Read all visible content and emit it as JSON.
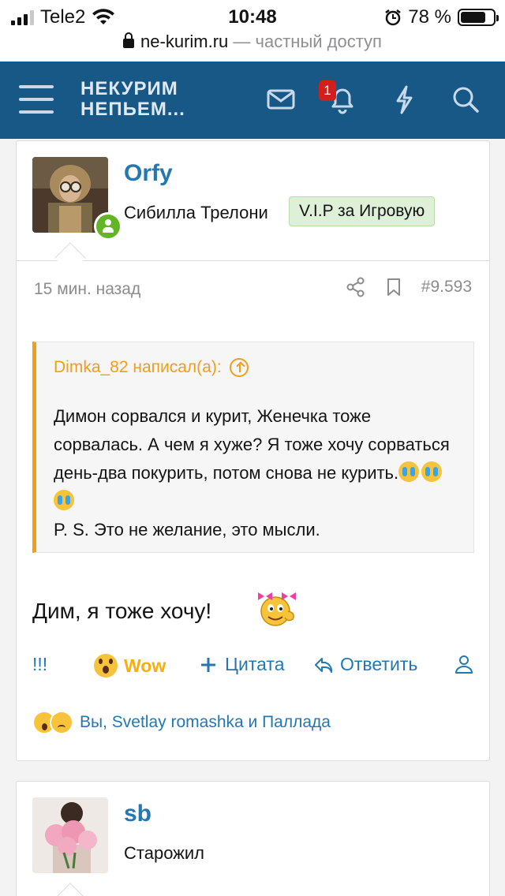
{
  "status": {
    "carrier": "Tele2",
    "time": "10:48",
    "battery": "78 %",
    "battery_level": 0.78
  },
  "browser": {
    "domain": "ne-kurim.ru",
    "suffix": "— частный доступ"
  },
  "header": {
    "logo_line1": "НЕКУРИМ",
    "logo_line2": "НЕПЬЕМ...",
    "notification_count": "1"
  },
  "post": {
    "username": "Orfy",
    "user_title": "Сибилла Трелони",
    "user_banner": "V.I.P за Игровую",
    "time": "15 мин. назад",
    "number": "#9.593",
    "quote": {
      "author_line": "Dimka_82 написал(а):",
      "text_main": "Димон сорвался и курит, Женечка тоже сорвалась. А чем я хуже? Я тоже хочу сорваться день-два покурить, потом снова не курить.",
      "text_ps": "P. S. Это не желание, это мысли."
    },
    "message": "Дим, я тоже хочу!",
    "actions": {
      "exclaim": "!!!",
      "wow": "Wow",
      "quote": "Цитата",
      "reply": "Ответить"
    },
    "reactions_text": "Вы, Svetlay romashka и Паллада"
  },
  "post2": {
    "username": "sb",
    "user_title": "Старожил"
  },
  "colors": {
    "header_bg": "#185886",
    "link": "#2577b1",
    "quote_accent": "#f49d18",
    "online": "#63b526",
    "badge": "#d0201d"
  }
}
